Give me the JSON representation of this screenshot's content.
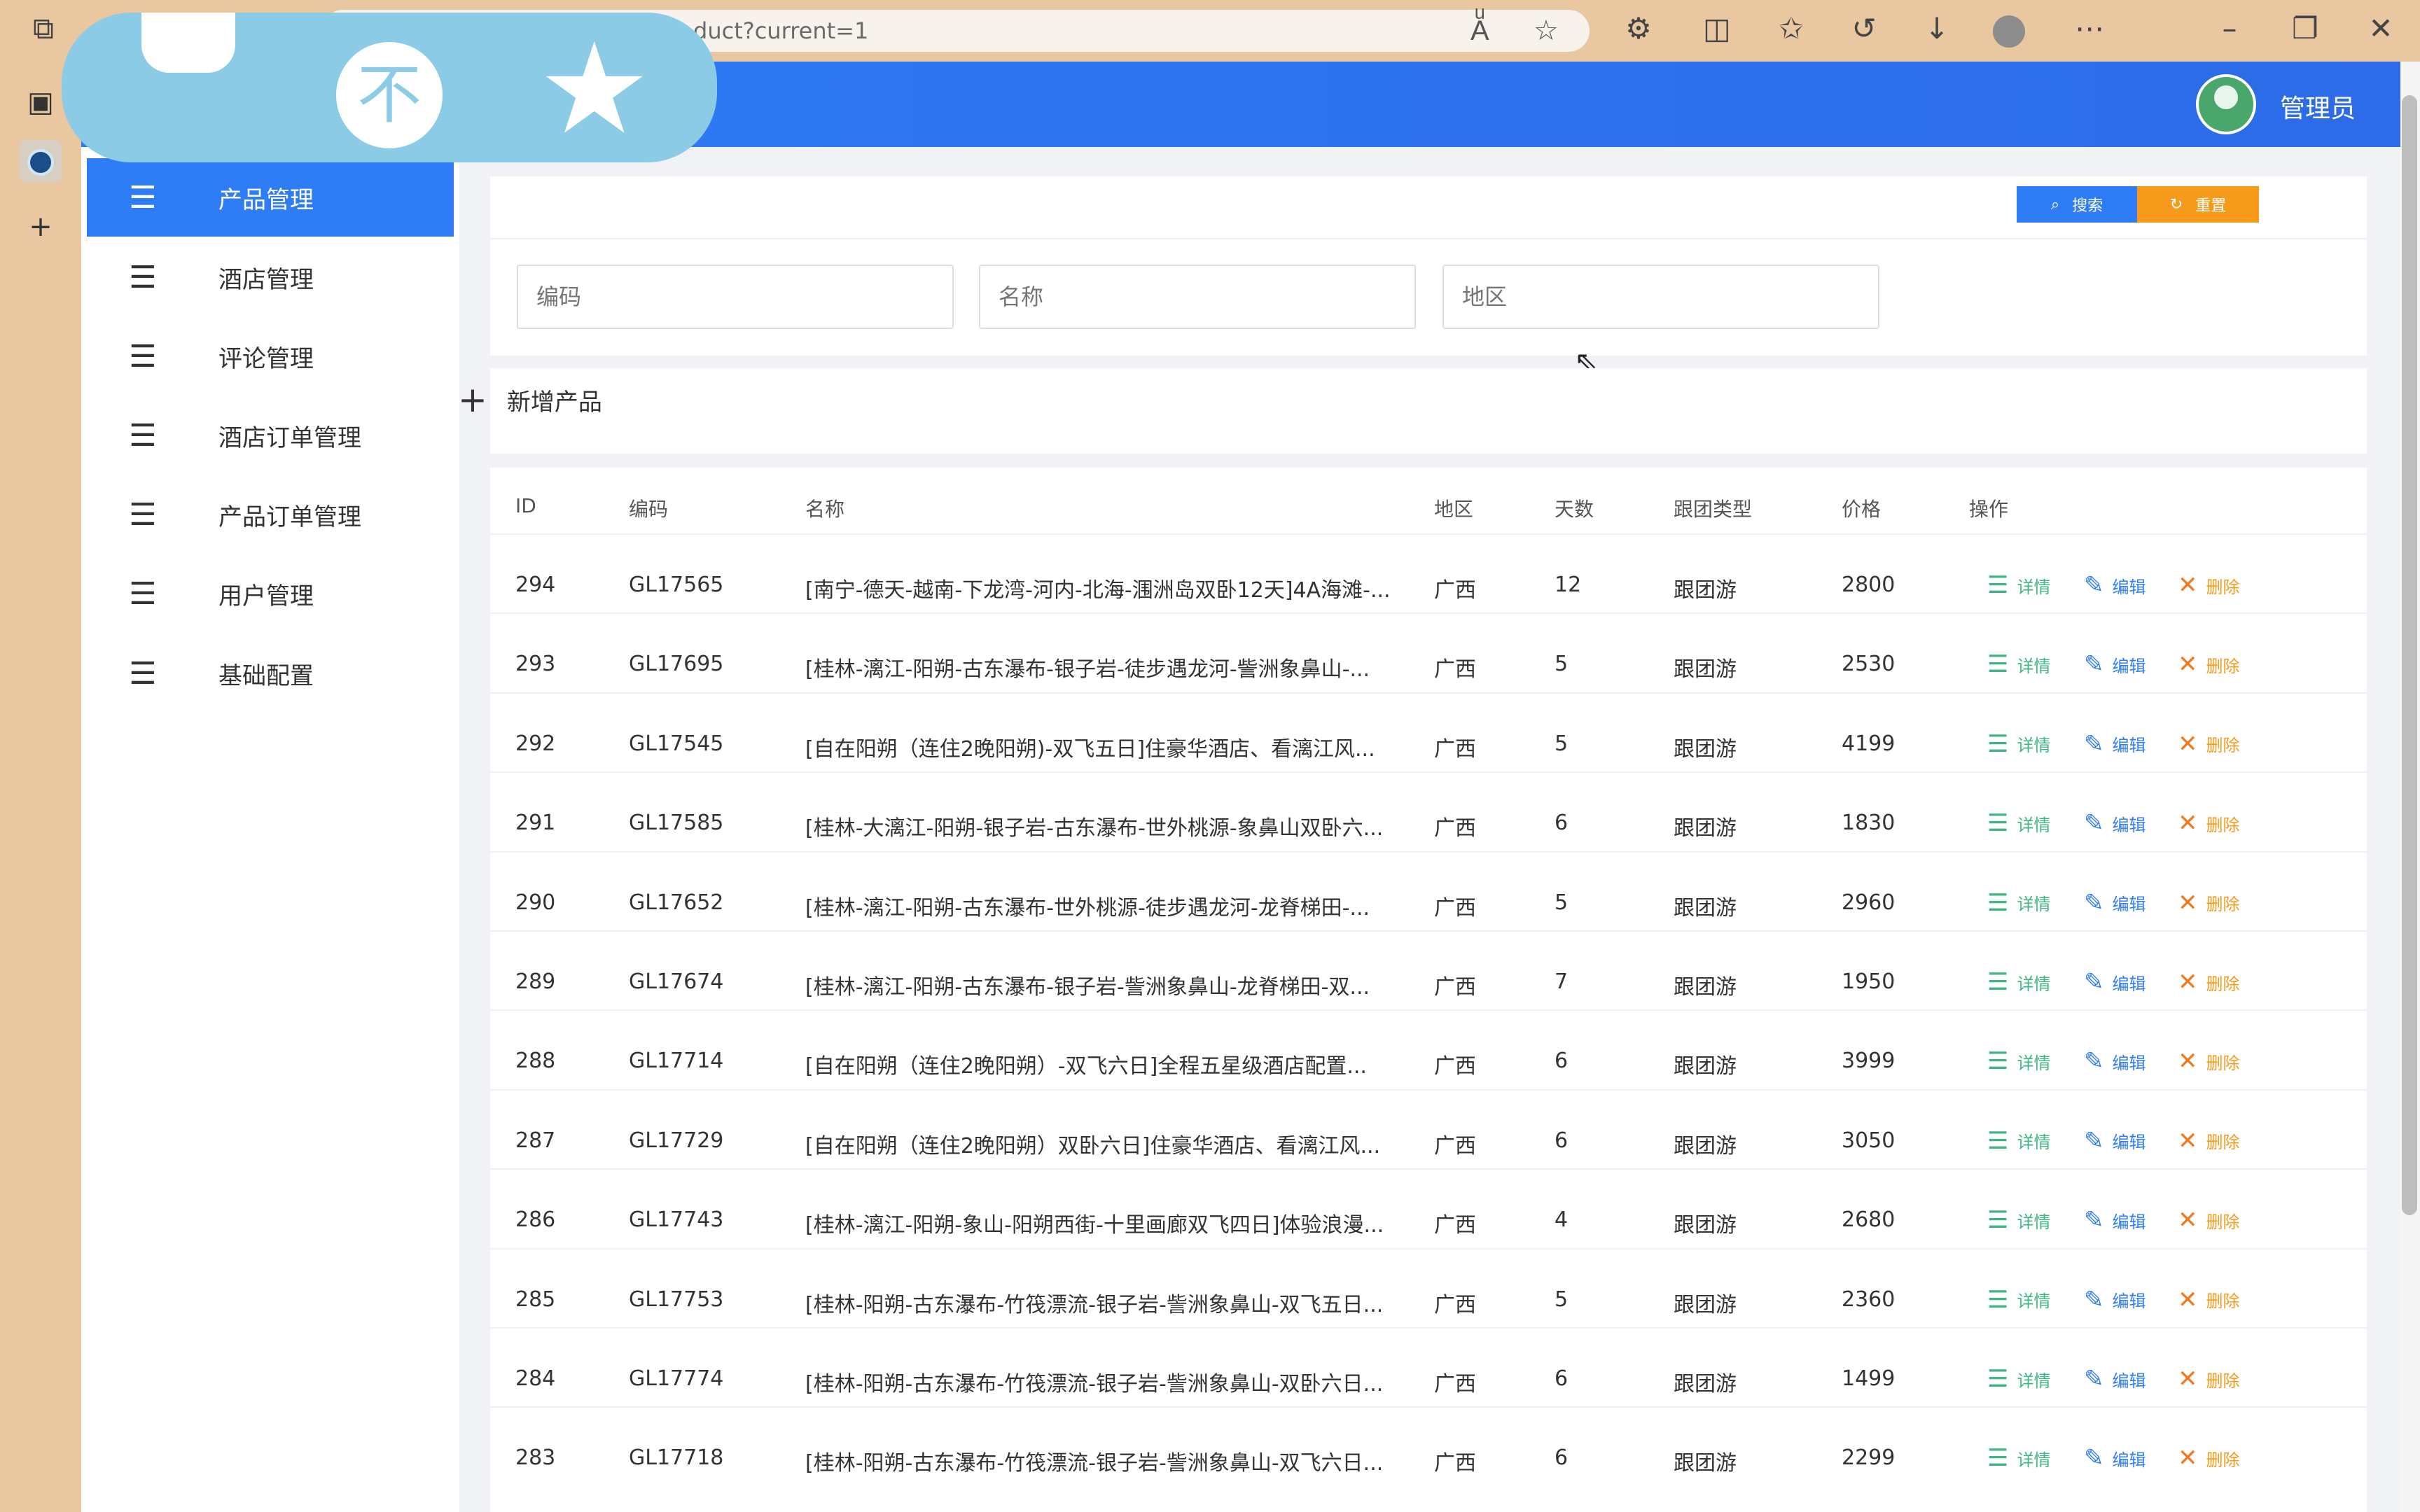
{
  "browser": {
    "url_visible": "duct?current=1"
  },
  "header": {
    "user_name": "管理员"
  },
  "sidebar": {
    "items": [
      {
        "label": "产品管理",
        "active": true
      },
      {
        "label": "酒店管理",
        "active": false
      },
      {
        "label": "评论管理",
        "active": false
      },
      {
        "label": "酒店订单管理",
        "active": false
      },
      {
        "label": "产品订单管理",
        "active": false
      },
      {
        "label": "用户管理",
        "active": false
      },
      {
        "label": "基础配置",
        "active": false
      }
    ]
  },
  "search": {
    "code_placeholder": "编码",
    "name_placeholder": "名称",
    "region_placeholder": "地区",
    "search_label": "搜索",
    "reset_label": "重置"
  },
  "toolbar": {
    "add_label": "新增产品"
  },
  "table": {
    "columns": [
      "ID",
      "编码",
      "名称",
      "地区",
      "天数",
      "跟团类型",
      "价格",
      "操作"
    ],
    "actions": {
      "detail": "详情",
      "edit": "编辑",
      "delete": "删除"
    },
    "rows": [
      {
        "id": "294",
        "code": "GL17565",
        "name": "[南宁-德天-越南-下龙湾-河内-北海-涠洲岛双卧12天]4A海滩-...",
        "region": "广西",
        "days": "12",
        "type": "跟团游",
        "price": "2800"
      },
      {
        "id": "293",
        "code": "GL17695",
        "name": "[桂林-漓江-阳朔-古东瀑布-银子岩-徒步遇龙河-訾洲象鼻山-...",
        "region": "广西",
        "days": "5",
        "type": "跟团游",
        "price": "2530"
      },
      {
        "id": "292",
        "code": "GL17545",
        "name": "[自在阳朔（连住2晚阳朔)-双飞五日]住豪华酒店、看漓江风...",
        "region": "广西",
        "days": "5",
        "type": "跟团游",
        "price": "4199"
      },
      {
        "id": "291",
        "code": "GL17585",
        "name": "[桂林-大漓江-阳朔-银子岩-古东瀑布-世外桃源-象鼻山双卧六...",
        "region": "广西",
        "days": "6",
        "type": "跟团游",
        "price": "1830"
      },
      {
        "id": "290",
        "code": "GL17652",
        "name": "[桂林-漓江-阳朔-古东瀑布-世外桃源-徒步遇龙河-龙脊梯田-...",
        "region": "广西",
        "days": "5",
        "type": "跟团游",
        "price": "2960"
      },
      {
        "id": "289",
        "code": "GL17674",
        "name": "[桂林-漓江-阳朔-古东瀑布-银子岩-訾洲象鼻山-龙脊梯田-双...",
        "region": "广西",
        "days": "7",
        "type": "跟团游",
        "price": "1950"
      },
      {
        "id": "288",
        "code": "GL17714",
        "name": "[自在阳朔（连住2晚阳朔）-双飞六日]全程五星级酒店配置...",
        "region": "广西",
        "days": "6",
        "type": "跟团游",
        "price": "3999"
      },
      {
        "id": "287",
        "code": "GL17729",
        "name": "[自在阳朔（连住2晚阳朔）双卧六日]住豪华酒店、看漓江风...",
        "region": "广西",
        "days": "6",
        "type": "跟团游",
        "price": "3050"
      },
      {
        "id": "286",
        "code": "GL17743",
        "name": "[桂林-漓江-阳朔-象山-阳朔西街-十里画廊双飞四日]体验浪漫...",
        "region": "广西",
        "days": "4",
        "type": "跟团游",
        "price": "2680"
      },
      {
        "id": "285",
        "code": "GL17753",
        "name": "[桂林-阳朔-古东瀑布-竹筏漂流-银子岩-訾洲象鼻山-双飞五日...",
        "region": "广西",
        "days": "5",
        "type": "跟团游",
        "price": "2360"
      },
      {
        "id": "284",
        "code": "GL17774",
        "name": "[桂林-阳朔-古东瀑布-竹筏漂流-银子岩-訾洲象鼻山-双卧六日...",
        "region": "广西",
        "days": "6",
        "type": "跟团游",
        "price": "1499"
      },
      {
        "id": "283",
        "code": "GL17718",
        "name": "[桂林-阳朔-古东瀑布-竹筏漂流-银子岩-訾洲象鼻山-双飞六日...",
        "region": "广西",
        "days": "6",
        "type": "跟团游",
        "price": "2299"
      }
    ]
  },
  "colors": {
    "primary": "#2f7df6",
    "warning": "#f59a1b",
    "success": "#3fb683",
    "browser_frame": "#e9c7a0",
    "overlay": "#8ccbe6"
  }
}
